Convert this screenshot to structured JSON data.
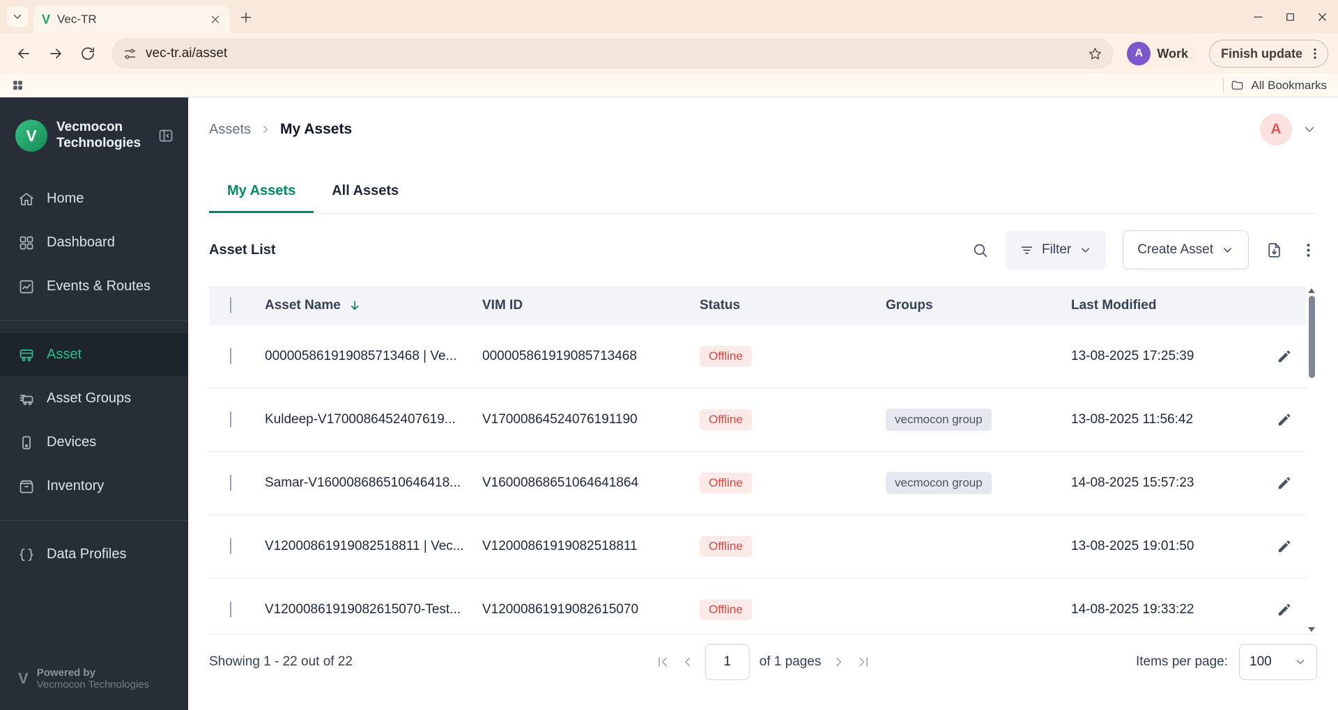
{
  "browser": {
    "tab_title": "Vec-TR",
    "url": "vec-tr.ai/asset",
    "profile_name": "Work",
    "update_label": "Finish update",
    "bookmarks_label": "All Bookmarks"
  },
  "sidebar": {
    "org_name": "Vecmocon Technologies",
    "items": [
      {
        "label": "Home",
        "icon": "home-icon",
        "active": false
      },
      {
        "label": "Dashboard",
        "icon": "dashboard-icon",
        "active": false
      },
      {
        "label": "Events & Routes",
        "icon": "events-routes-icon",
        "active": false
      },
      {
        "label": "Asset",
        "icon": "asset-icon",
        "active": true
      },
      {
        "label": "Asset Groups",
        "icon": "asset-groups-icon",
        "active": false
      },
      {
        "label": "Devices",
        "icon": "devices-icon",
        "active": false
      },
      {
        "label": "Inventory",
        "icon": "inventory-icon",
        "active": false
      },
      {
        "label": "Data Profiles",
        "icon": "data-profiles-icon",
        "active": false
      }
    ],
    "footer": {
      "powered_by": "Powered by",
      "org": "Vecmocon Technologies"
    }
  },
  "main": {
    "breadcrumb": {
      "parent": "Assets",
      "current": "My Assets"
    },
    "avatar_letter": "A",
    "tabs": [
      {
        "label": "My Assets",
        "active": true
      },
      {
        "label": "All Assets",
        "active": false
      }
    ],
    "list": {
      "title": "Asset List",
      "filter": "Filter",
      "create": "Create Asset"
    },
    "table": {
      "columns": [
        "Asset Name",
        "VIM ID",
        "Status",
        "Groups",
        "Last Modified"
      ],
      "rows": [
        {
          "name": "000005861919085713468 | Ve...",
          "vim": "000005861919085713468",
          "status": "Offline",
          "group": "",
          "modified": "13-08-2025 17:25:39"
        },
        {
          "name": "Kuldeep-V1700086452407619...",
          "vim": "V17000864524076191190",
          "status": "Offline",
          "group": "vecmocon group",
          "modified": "13-08-2025 11:56:42"
        },
        {
          "name": "Samar-V160008686510646418...",
          "vim": "V16000868651064641864",
          "status": "Offline",
          "group": "vecmocon group",
          "modified": "14-08-2025 15:57:23"
        },
        {
          "name": "V12000861919082518811 | Vec...",
          "vim": "V12000861919082518811",
          "status": "Offline",
          "group": "",
          "modified": "13-08-2025 19:01:50"
        },
        {
          "name": "V12000861919082615070-Test...",
          "vim": "V12000861919082615070",
          "status": "Offline",
          "group": "",
          "modified": "14-08-2025 19:33:22"
        }
      ]
    },
    "pagination": {
      "showing": "Showing 1 - 22 out of 22",
      "page": "1",
      "of_pages": "of 1 pages",
      "items_per_page_label": "Items per page:",
      "items_per_page": "100"
    }
  },
  "colors": {
    "accent_green": "#008A66",
    "sidebar_bg": "#272E37",
    "offline_bg": "#FBEAE8",
    "offline_text": "#CF4B45",
    "chip_bg": "#E5E8EE",
    "browser_theme": "#F9E8DC",
    "profile_purple": "#7B57C9"
  }
}
